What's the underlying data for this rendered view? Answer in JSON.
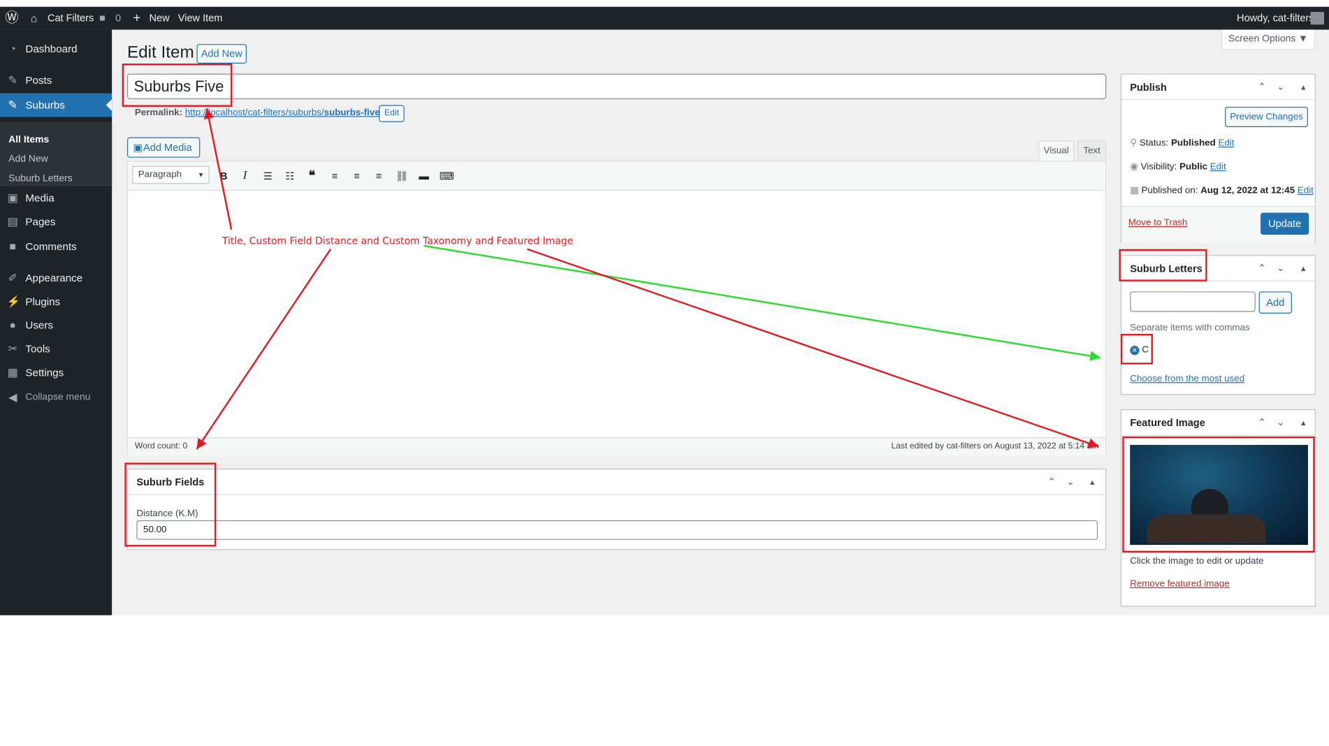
{
  "admin_bar": {
    "site_name": "Cat Filters",
    "comments_count": "0",
    "new_label": "New",
    "view_item_label": "View Item",
    "howdy": "Howdy, cat-filters"
  },
  "sidebar": {
    "dashboard": "Dashboard",
    "posts": "Posts",
    "suburbs": "Suburbs",
    "sub_all_items": "All Items",
    "sub_add_new": "Add New",
    "sub_suburb_letters": "Suburb Letters",
    "media": "Media",
    "pages": "Pages",
    "comments": "Comments",
    "appearance": "Appearance",
    "plugins": "Plugins",
    "users": "Users",
    "tools": "Tools",
    "settings": "Settings",
    "collapse": "Collapse menu"
  },
  "header": {
    "screen_options": "Screen Options ▼",
    "title": "Edit Item",
    "add_new": "Add New"
  },
  "post": {
    "title_value": "Suburbs Five",
    "permalink_label": "Permalink:",
    "permalink_base": "http://localhost/cat-filters/suburbs/",
    "permalink_slug": "suburbs-five",
    "permalink_end": "/",
    "edit_slug": "Edit"
  },
  "editor": {
    "add_media": "Add Media",
    "tab_visual": "Visual",
    "tab_text": "Text",
    "format_select": "Paragraph",
    "word_count": "Word count: 0",
    "last_edited": "Last edited by cat-filters on August 13, 2022 at 5:14 am"
  },
  "suburb_fields": {
    "title": "Suburb Fields",
    "distance_label": "Distance (K.M)",
    "distance_value": "50.00"
  },
  "publish": {
    "title": "Publish",
    "preview": "Preview Changes",
    "status_label": "Status:",
    "status_value": "Published",
    "visibility_label": "Visibility:",
    "visibility_value": "Public",
    "published_on_label": "Published on:",
    "published_on_value": "Aug 12, 2022 at 12:45",
    "edit": "Edit",
    "trash": "Move to Trash",
    "update": "Update"
  },
  "suburb_letters": {
    "title": "Suburb Letters",
    "add": "Add",
    "hint": "Separate items with commas",
    "tag": "C",
    "most_used": "Choose from the most used"
  },
  "featured_image": {
    "title": "Featured Image",
    "hint": "Click the image to edit or update",
    "remove": "Remove featured image"
  },
  "annotation": {
    "text": "Title, Custom Field Distance and Custom Taxonomy and Featured Image"
  },
  "colors": {
    "admin_dark": "#1d2327",
    "accent": "#2271b1",
    "annotation_red": "#e01b24",
    "annotation_green": "#2bdc2b"
  }
}
